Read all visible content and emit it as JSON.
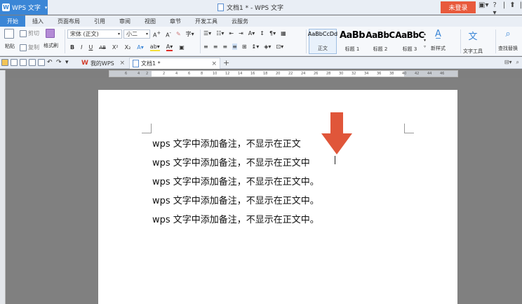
{
  "app": {
    "menu_label": "WPS 文字",
    "window_title": "文档1 * - WPS 文字",
    "login_label": "未登录",
    "controls": [
      "▣▾",
      "?▾",
      "|",
      "⬆",
      "|"
    ]
  },
  "ribbon_tabs": [
    "开始",
    "插入",
    "页面布局",
    "引用",
    "审阅",
    "视图",
    "章节",
    "开发工具",
    "云服务"
  ],
  "ribbon": {
    "cut": "剪切",
    "paste": "粘贴",
    "copy": "复制",
    "format_painter": "格式刷",
    "font_name": "宋体 (正文)",
    "font_size": "小二",
    "styles": [
      {
        "preview": "AaBbCcDd",
        "label": "正文"
      },
      {
        "preview": "AaBb",
        "label": "标题 1"
      },
      {
        "preview": "AaBbC",
        "label": "标题 2"
      },
      {
        "preview": "AaBbC",
        "label": "标题 3"
      }
    ],
    "new_style": "新样式",
    "text_tools": "文字工具",
    "find_replace": "查找替换",
    "bold": "B",
    "italic": "I",
    "underline": "U",
    "strikethrough": "AB",
    "superscript": "X²",
    "subscript": "X₂"
  },
  "doc_tabs": {
    "mywps": "我的WPS",
    "doc1": "文档1 *"
  },
  "ruler_ticks": [
    "6",
    "4",
    "2",
    "2",
    "4",
    "6",
    "8",
    "10",
    "12",
    "14",
    "16",
    "18",
    "20",
    "22",
    "24",
    "26",
    "28",
    "30",
    "32",
    "34",
    "36",
    "38",
    "40",
    "42",
    "44",
    "46"
  ],
  "document": {
    "lines": [
      "wps 文字中添加备注，不显示在正文",
      "wps 文字中添加备注，不显示在正文中",
      "wps 文字中添加备注，不显示在正文中。",
      "wps 文字中添加备注，不显示在正文中。",
      "wps 文字中添加备注，不显示在正文中。"
    ]
  },
  "annotation": {
    "arrow_color": "#e0563a"
  }
}
